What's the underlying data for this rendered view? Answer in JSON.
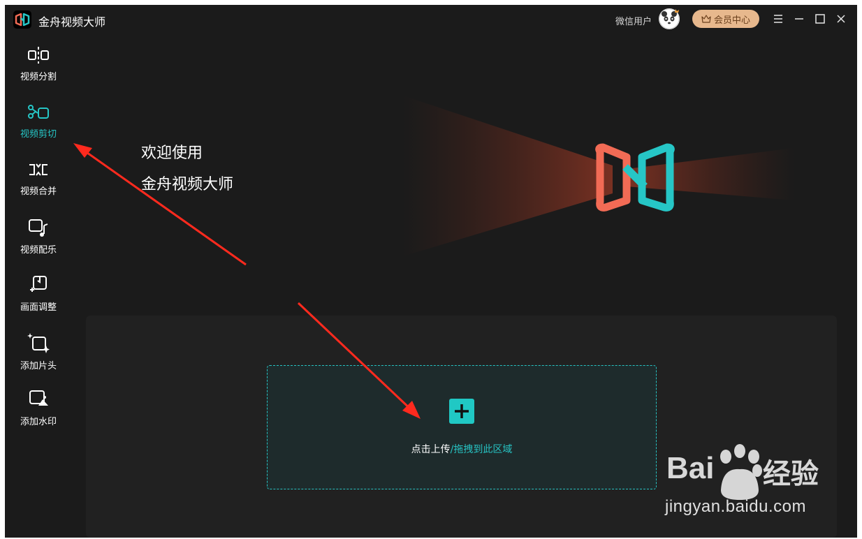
{
  "app": {
    "title": "金舟视频大师"
  },
  "header": {
    "user_name": "微信用户",
    "vip_label": "会员中心"
  },
  "sidebar": {
    "items": [
      {
        "label": "视频分割",
        "icon": "video-split-icon",
        "active": false
      },
      {
        "label": "视频剪切",
        "icon": "scissors-icon",
        "active": true
      },
      {
        "label": "视频合并",
        "icon": "video-merge-icon",
        "active": false
      },
      {
        "label": "视频配乐",
        "icon": "music-icon",
        "active": false
      },
      {
        "label": "画面调整",
        "icon": "crop-adjust-icon",
        "active": false
      },
      {
        "label": "添加片头",
        "icon": "sparkle-frame-icon",
        "active": false
      },
      {
        "label": "添加水印",
        "icon": "watermark-image-icon",
        "active": false
      }
    ]
  },
  "welcome": {
    "line1": "欢迎使用",
    "line2": "金舟视频大师"
  },
  "upload": {
    "click_text": "点击上传",
    "drag_text": "/拖拽到此区域"
  },
  "watermark": {
    "brand": "Bai",
    "brand_cn": "经验",
    "url": "jingyan.baidu.com"
  },
  "colors": {
    "accent": "#26c6c6",
    "logo_red": "#f26b55",
    "vip_bg": "#e7b88d",
    "annotation": "#ff2a1e"
  }
}
